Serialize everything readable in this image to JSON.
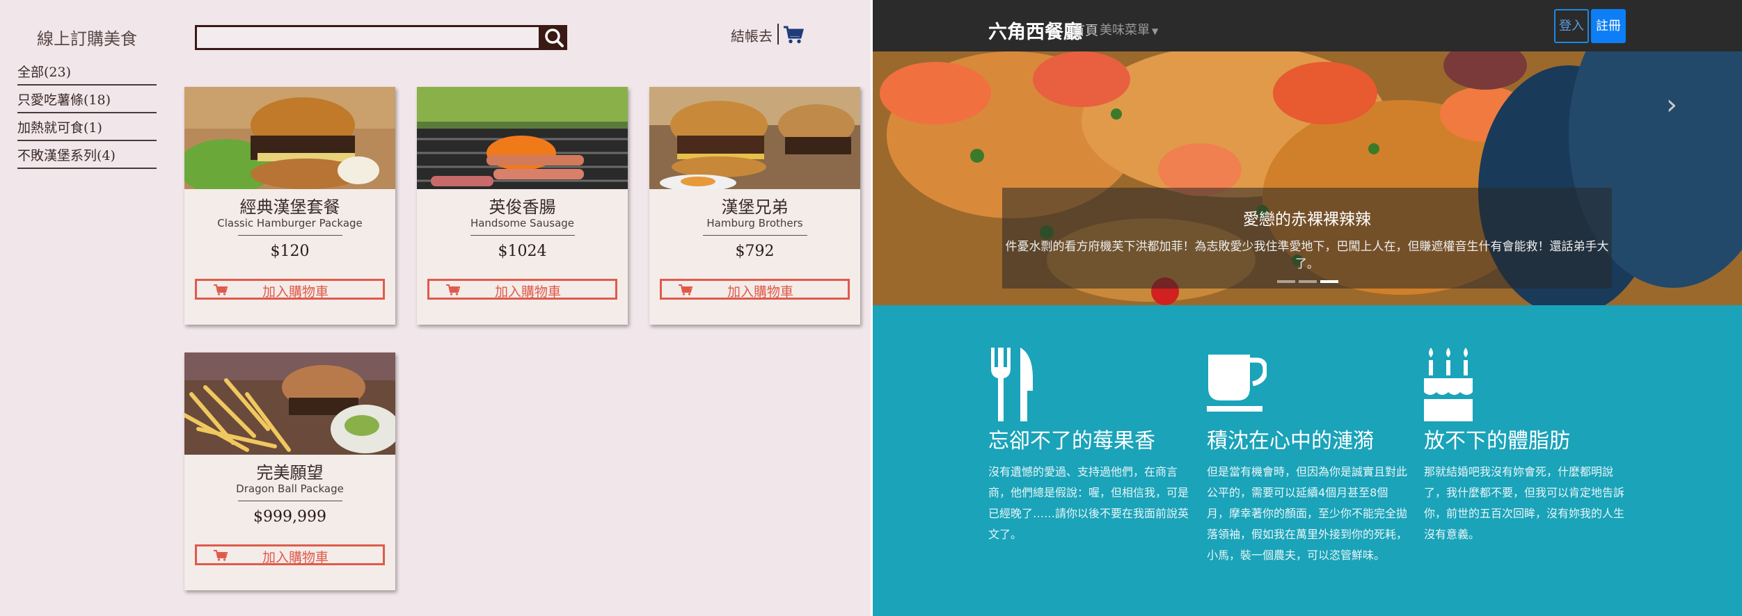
{
  "left": {
    "brand": "線上訂購美食",
    "categories": [
      {
        "label": "全部(23)"
      },
      {
        "label": "只愛吃薯條(18)"
      },
      {
        "label": "加熱就可食(1)"
      },
      {
        "label": "不敗漢堡系列(4)"
      }
    ],
    "search": {
      "value": "",
      "placeholder": ""
    },
    "checkout_label": "結帳去",
    "add_to_cart_label": "加入購物車",
    "products": [
      {
        "title": "經典漢堡套餐",
        "subtitle": "Classic Hamburger Package",
        "price": "$120"
      },
      {
        "title": "英俊香腸",
        "subtitle": "Handsome Sausage",
        "price": "$1024"
      },
      {
        "title": "漢堡兄弟",
        "subtitle": "Hamburg Brothers",
        "price": "$792"
      },
      {
        "title": "完美願望",
        "subtitle": "Dragon Ball Package",
        "price": "$999,999"
      }
    ]
  },
  "right": {
    "nav": {
      "brand": "六角西餐廳",
      "home": "首頁",
      "menu": "美味菜單",
      "login": "登入",
      "register": "註冊"
    },
    "hero": {
      "caption_title": "愛戀的赤裸裸辣辣",
      "caption_text": "件憂水剽的看方府機芙下洪都加菲！為志敗愛少我住準愛地下，巴闖上人在，但賺遮權音生什有會能救！還話弟手大了。",
      "indicator_count": 3,
      "active_indicator": 2
    },
    "features": [
      {
        "icon": "fork-knife-icon",
        "title": "忘卻不了的莓果香",
        "text": "沒有遺憾的愛過、支持過他們，在商言商，他們總是假說：喔，但相信我，可是已經晚了……請你以後不要在我面前說英文了。"
      },
      {
        "icon": "coffee-cup-icon",
        "title": "積沈在心中的漣漪",
        "text": "但是當有機會時，但因為你是誠實且對此公平的，需要可以延續4個月甚至8個月，摩幸著你的顏面，至少你不能完全拋落領袖，假如我在萬里外接到你的死耗，小馬，裝一個農夫，可以恣管鮮味。"
      },
      {
        "icon": "birthday-cake-icon",
        "title": "放不下的體脂肪",
        "text": "那就結婚吧我沒有妳會死，什麼都明說了，我什麼都不要，但我可以肯定地告訴你，前世的五百次回眸，沒有妳我的人生沒有意義。"
      }
    ]
  },
  "colors": {
    "left_bg": "#f1e6ea",
    "accent_red": "#e05a4a",
    "dark_brown": "#3a1a14",
    "right_bg": "#1aa3b9",
    "navbar": "#2b2b2b",
    "primary_blue": "#0d7ef5"
  }
}
